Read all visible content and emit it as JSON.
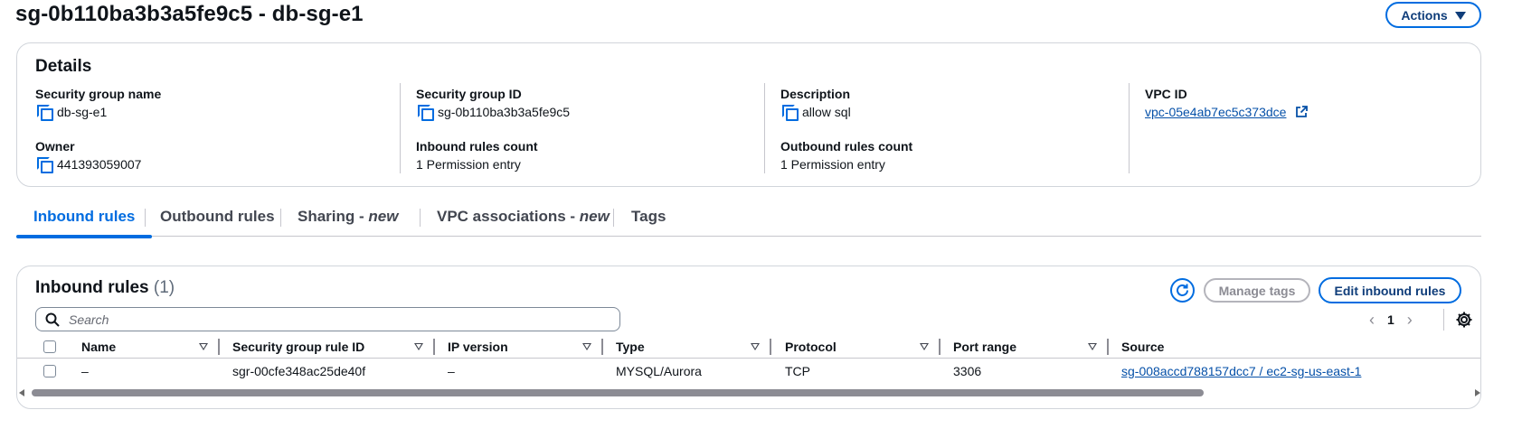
{
  "page": {
    "title": "sg-0b110ba3b3a5fe9c5 - db-sg-e1",
    "actions_label": "Actions"
  },
  "details": {
    "heading": "Details",
    "sg_name_label": "Security group name",
    "sg_name_value": "db-sg-e1",
    "sg_id_label": "Security group ID",
    "sg_id_value": "sg-0b110ba3b3a5fe9c5",
    "description_label": "Description",
    "description_value": "allow sql",
    "vpc_id_label": "VPC ID",
    "vpc_id_value": "vpc-05e4ab7ec5c373dce",
    "owner_label": "Owner",
    "owner_value": "441393059007",
    "inbound_count_label": "Inbound rules count",
    "inbound_count_value": "1 Permission entry",
    "outbound_count_label": "Outbound rules count",
    "outbound_count_value": "1 Permission entry"
  },
  "tabs": [
    {
      "label": "Inbound rules",
      "suffix": ""
    },
    {
      "label": "Outbound rules",
      "suffix": ""
    },
    {
      "label": "Sharing - ",
      "suffix": "new"
    },
    {
      "label": "VPC associations - ",
      "suffix": "new"
    },
    {
      "label": "Tags",
      "suffix": ""
    }
  ],
  "rules_panel": {
    "heading": "Inbound rules",
    "count": "(1)",
    "manage_tags_label": "Manage tags",
    "edit_label": "Edit inbound rules",
    "search_placeholder": "Search",
    "page_number": "1",
    "columns": [
      "Name",
      "Security group rule ID",
      "IP version",
      "Type",
      "Protocol",
      "Port range",
      "Source"
    ],
    "rows": [
      {
        "name": "–",
        "rule_id": "sgr-00cfe348ac25de40f",
        "ip_version": "–",
        "type": "MYSQL/Aurora",
        "protocol": "TCP",
        "port_range": "3306",
        "source": "sg-008accd788157dcc7 / ec2-sg-us-east-1"
      }
    ]
  },
  "colors": {
    "accent": "#006ce0",
    "link": "#0550a8",
    "border": "#d1d5db"
  }
}
